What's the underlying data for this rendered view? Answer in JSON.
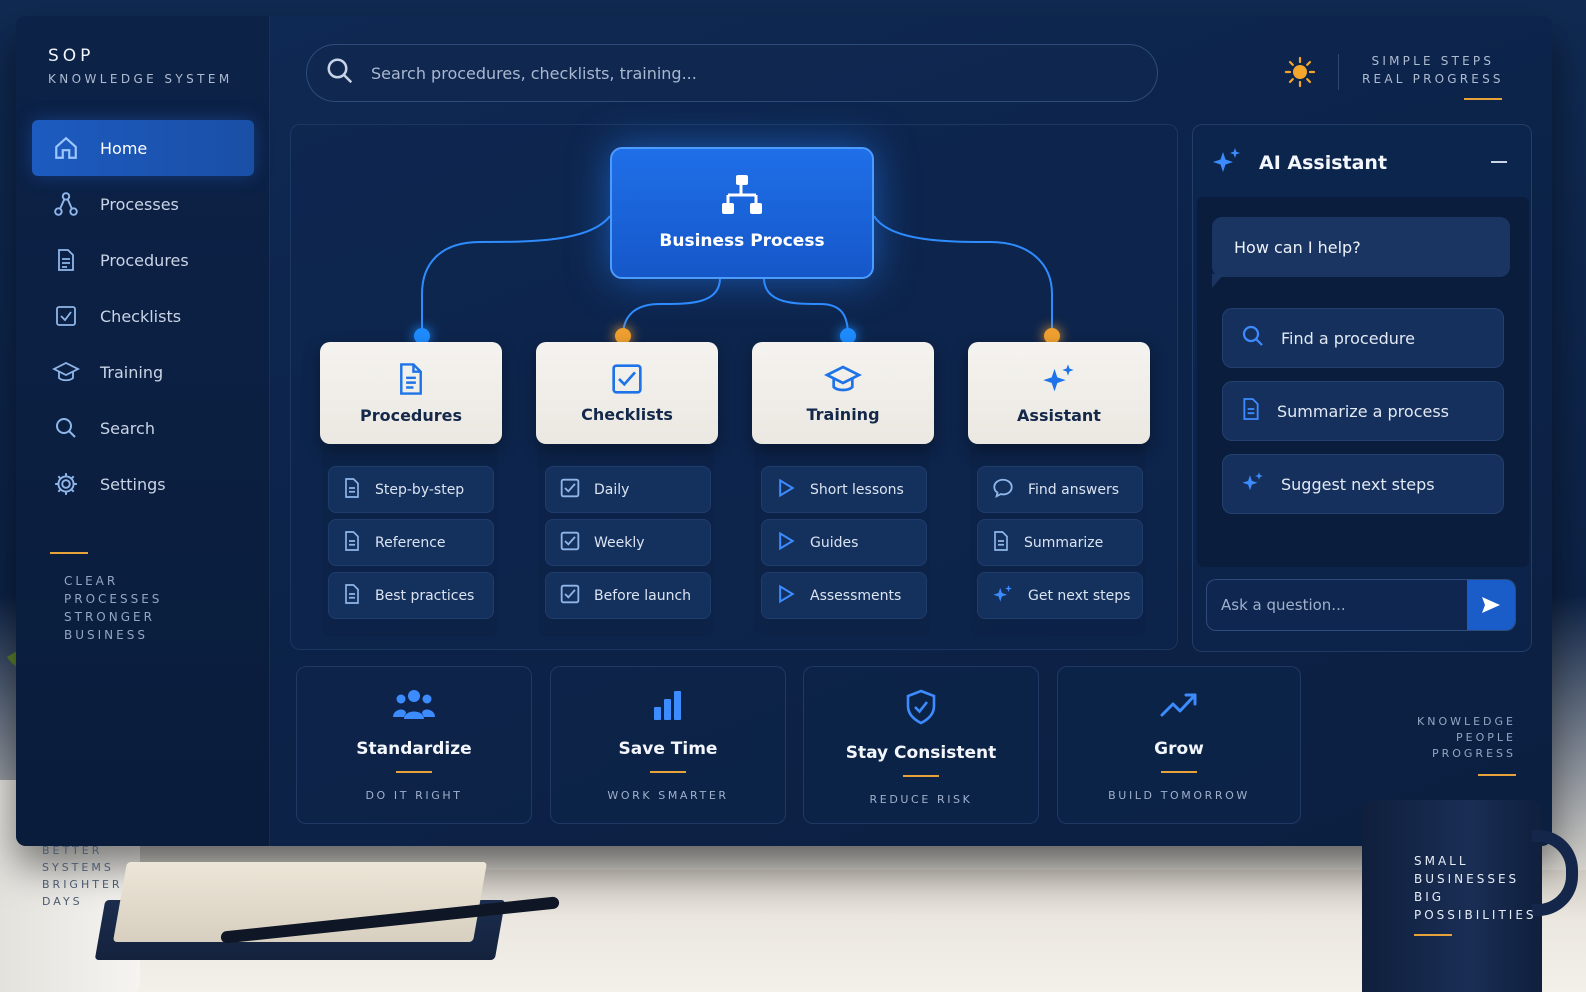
{
  "brand": {
    "title": "SOP",
    "subtitle": "KNOWLEDGE SYSTEM"
  },
  "sidebar": {
    "items": [
      {
        "label": "Home",
        "icon": "home-icon",
        "active": true
      },
      {
        "label": "Processes",
        "icon": "process-nodes-icon"
      },
      {
        "label": "Procedures",
        "icon": "document-icon"
      },
      {
        "label": "Checklists",
        "icon": "checkbox-icon"
      },
      {
        "label": "Training",
        "icon": "graduation-cap-icon"
      },
      {
        "label": "Search",
        "icon": "search-icon"
      },
      {
        "label": "Settings",
        "icon": "gear-icon"
      }
    ],
    "note": [
      "CLEAR",
      "PROCESSES",
      "STRONGER",
      "BUSINESS"
    ]
  },
  "search": {
    "placeholder": "Search procedures, checklists, training..."
  },
  "tagline": [
    "SIMPLE STEPS",
    "REAL PROGRESS"
  ],
  "diagram": {
    "root": {
      "label": "Business Process",
      "icon": "org-chart-icon"
    },
    "categories": [
      {
        "label": "Procedures",
        "icon": "document-icon",
        "dot_color": "#1e8cff",
        "items": [
          "Step-by-step",
          "Reference",
          "Best practices"
        ],
        "item_icon": "document-icon"
      },
      {
        "label": "Checklists",
        "icon": "checkbox-icon",
        "dot_color": "#f0a030",
        "items": [
          "Daily",
          "Weekly",
          "Before launch"
        ],
        "item_icon": "checkbox-icon"
      },
      {
        "label": "Training",
        "icon": "graduation-cap-icon",
        "dot_color": "#1e8cff",
        "items": [
          "Short lessons",
          "Guides",
          "Assessments"
        ],
        "item_icon": "play-icon"
      },
      {
        "label": "Assistant",
        "icon": "sparkle-icon",
        "dot_color": "#f0a030",
        "items": [
          "Find answers",
          "Summarize",
          "Get next steps"
        ],
        "item_icons": [
          "chat-bubble-icon",
          "document-icon",
          "sparkle-icon"
        ]
      }
    ]
  },
  "ai": {
    "title": "AI Assistant",
    "greeting": "How can I help?",
    "suggestions": [
      {
        "label": "Find a procedure",
        "icon": "search-icon"
      },
      {
        "label": "Summarize a process",
        "icon": "document-icon"
      },
      {
        "label": "Suggest next steps",
        "icon": "sparkle-icon"
      }
    ],
    "input_placeholder": "Ask a question..."
  },
  "benefits": [
    {
      "title": "Standardize",
      "sub": "DO IT RIGHT",
      "icon": "people-icon"
    },
    {
      "title": "Save Time",
      "sub": "WORK SMARTER",
      "icon": "bar-chart-icon"
    },
    {
      "title": "Stay Consistent",
      "sub": "REDUCE RISK",
      "icon": "shield-check-icon"
    },
    {
      "title": "Grow",
      "sub": "BUILD TOMORROW",
      "icon": "trend-up-icon"
    }
  ],
  "right_note": [
    "KNOWLEDGE",
    "PEOPLE",
    "PROGRESS"
  ],
  "desk": {
    "plant_note": [
      "BETTER",
      "SYSTEMS",
      "BRIGHTER",
      "DAYS"
    ],
    "mug_text": [
      "SMALL",
      "BUSINESSES",
      "BIG",
      "POSSIBILITIES"
    ]
  },
  "colors": {
    "accent": "#e8a23a",
    "primary": "#1f6fe8",
    "dot_blue": "#1e8cff",
    "dot_orange": "#f0a030"
  }
}
